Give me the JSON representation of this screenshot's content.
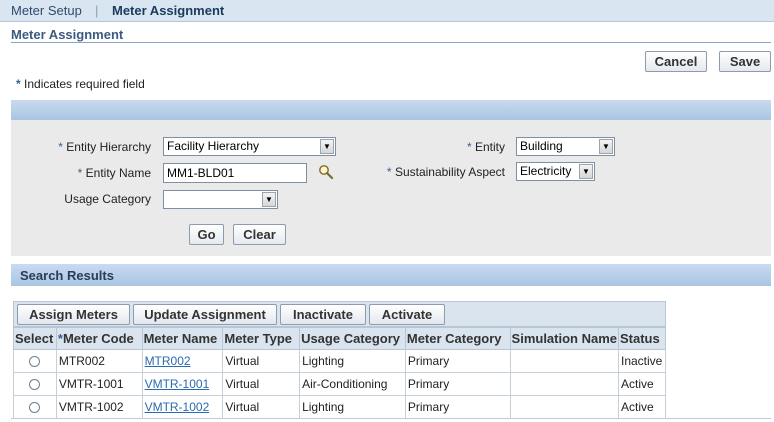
{
  "subtabs": {
    "item1": "Meter Setup",
    "separator": "|",
    "item2": "Meter Assignment"
  },
  "page_title": "Meter Assignment",
  "buttons": {
    "cancel": "Cancel",
    "save": "Save"
  },
  "required_note": {
    "star": "*",
    "text": "Indicates required field"
  },
  "search": {
    "entity_hierarchy": {
      "label": "Entity Hierarchy",
      "required": "*",
      "value": "Facility Hierarchy"
    },
    "entity_name": {
      "label": "Entity Name",
      "required": "*",
      "value": "MM1-BLD01"
    },
    "usage_category": {
      "label": "Usage Category",
      "value": ""
    },
    "entity": {
      "label": "Entity",
      "required": "*",
      "value": "Building"
    },
    "sustainability_aspect": {
      "label": "Sustainability Aspect",
      "required": "*",
      "value": "Electricity"
    },
    "go": "Go",
    "clear": "Clear"
  },
  "results": {
    "title": "Search Results",
    "actions": [
      "Assign Meters",
      "Update Assignment",
      "Inactivate",
      "Activate"
    ],
    "columns": {
      "select": "Select",
      "meter_code_star": "*",
      "meter_code": "Meter Code",
      "meter_name": "Meter Name",
      "meter_type": "Meter Type",
      "usage_category": "Usage Category",
      "meter_category": "Meter Category",
      "simulation_name": "Simulation Name",
      "status": "Status"
    },
    "rows": [
      {
        "code": "MTR002",
        "name": "MTR002",
        "type": "Virtual",
        "usage": "Lighting",
        "category": "Primary",
        "simulation": "",
        "status": "Inactive"
      },
      {
        "code": "VMTR-1001",
        "name": "VMTR-1001",
        "type": "Virtual",
        "usage": "Air-Conditioning",
        "category": "Primary",
        "simulation": "",
        "status": "Active"
      },
      {
        "code": "VMTR-1002",
        "name": "VMTR-1002",
        "type": "Virtual",
        "usage": "Lighting",
        "category": "Primary",
        "simulation": "",
        "status": "Active"
      }
    ]
  },
  "colors": {
    "link": "#2a6bb0",
    "header_blue": "#a9c4e2",
    "required_star": "#3a5f91"
  }
}
